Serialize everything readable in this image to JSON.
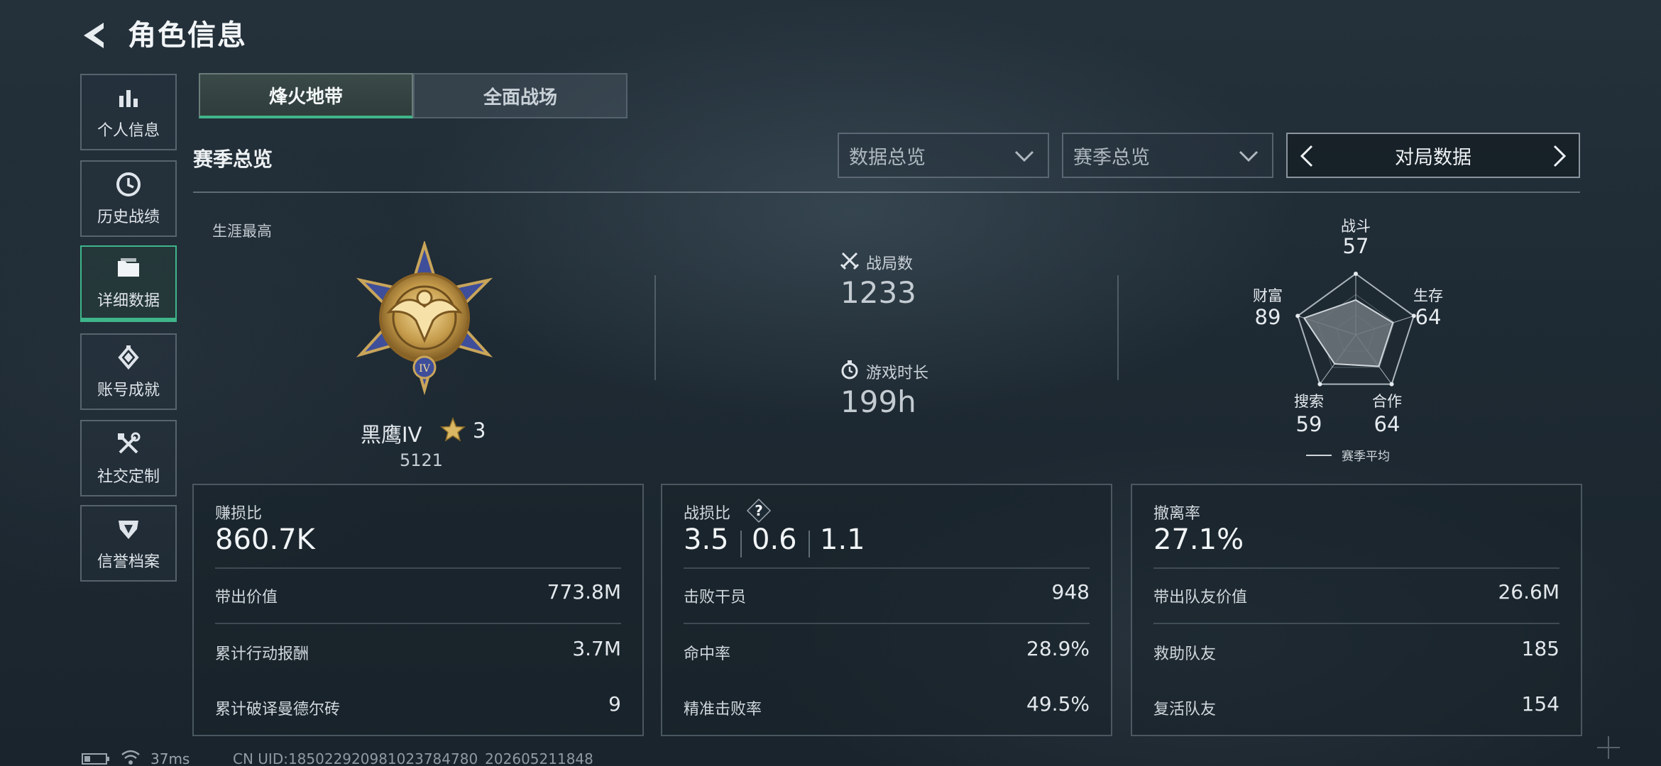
{
  "header": {
    "title": "角色信息"
  },
  "sidebar": {
    "items": [
      {
        "label": "个人信息",
        "icon": "bar-chart-icon"
      },
      {
        "label": "历史战绩",
        "icon": "clock-icon"
      },
      {
        "label": "详细数据",
        "icon": "folder-icon",
        "active": true
      },
      {
        "label": "账号成就",
        "icon": "medal-icon"
      },
      {
        "label": "社交定制",
        "icon": "tools-icon"
      },
      {
        "label": "信誉档案",
        "icon": "shield-icon"
      }
    ]
  },
  "tabs": [
    {
      "label": "烽火地带",
      "active": true
    },
    {
      "label": "全面战场",
      "active": false
    }
  ],
  "section": {
    "title": "赛季总览"
  },
  "filters": {
    "data_select": "数据总览",
    "season_select": "赛季总览",
    "pager_label": "对局数据"
  },
  "career": {
    "label": "生涯最高",
    "rank_name": "黑鹰IV",
    "rank_stars": "3",
    "rank_points": "5121"
  },
  "stats": {
    "matches_label": "战局数",
    "matches_value": "1233",
    "playtime_label": "游戏时长",
    "playtime_value": "199h"
  },
  "radar": {
    "axes": [
      {
        "label": "战斗",
        "value": "57"
      },
      {
        "label": "生存",
        "value": "64"
      },
      {
        "label": "合作",
        "value": "64"
      },
      {
        "label": "搜索",
        "value": "59"
      },
      {
        "label": "财富",
        "value": "89"
      }
    ],
    "legend": "赛季平均"
  },
  "panels": {
    "profit": {
      "title": "赚损比",
      "value": "860.7K",
      "rows": [
        {
          "label": "带出价值",
          "value": "773.8M"
        },
        {
          "label": "累计行动报酬",
          "value": "3.7M"
        },
        {
          "label": "累计破译曼德尔砖",
          "value": "9"
        }
      ]
    },
    "combat": {
      "title": "战损比",
      "help": "?",
      "ratios": [
        "3.5",
        "0.6",
        "1.1"
      ],
      "rows": [
        {
          "label": "击败干员",
          "value": "948"
        },
        {
          "label": "命中率",
          "value": "28.9%"
        },
        {
          "label": "精准击败率",
          "value": "49.5%"
        }
      ]
    },
    "extract": {
      "title": "撤离率",
      "value": "27.1%",
      "rows": [
        {
          "label": "带出队友价值",
          "value": "26.6M"
        },
        {
          "label": "救助队友",
          "value": "185"
        },
        {
          "label": "复活队友",
          "value": "154"
        }
      ]
    }
  },
  "footer": {
    "ping": "37ms",
    "uid": "CN UID:185022920981023784780_202605211848"
  },
  "colors": {
    "accent": "#3fb58a",
    "background": "#1e2a33",
    "radar_fill": "#6f777d"
  }
}
